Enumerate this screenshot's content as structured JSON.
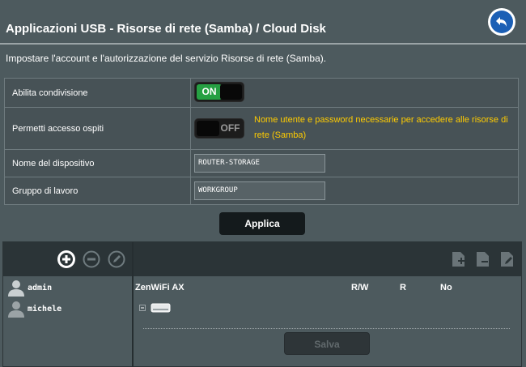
{
  "header": {
    "title": "Applicazioni USB - Risorse di rete (Samba) / Cloud Disk",
    "subtitle": "Impostare l'account e l'autorizzazione del servizio Risorse di rete (Samba)."
  },
  "settings": {
    "enable_share": {
      "label": "Abilita condivisione",
      "toggle_text": "ON",
      "state": "on"
    },
    "guest_access": {
      "label": "Permetti accesso ospiti",
      "toggle_text": "OFF",
      "state": "off",
      "hint": "Nome utente e password necessarie per accedere alle risorse di rete (Samba)"
    },
    "device_name": {
      "label": "Nome del dispositivo",
      "value": "ROUTER-STORAGE"
    },
    "workgroup": {
      "label": "Gruppo di lavoro",
      "value": "WORKGROUP"
    }
  },
  "buttons": {
    "apply": "Applica",
    "save": "Salva"
  },
  "users": [
    {
      "name": "admin"
    },
    {
      "name": "michele"
    }
  ],
  "share_table": {
    "device": "ZenWiFi AX",
    "columns": [
      "R/W",
      "R",
      "No"
    ]
  },
  "colors": {
    "background": "#4d5a5e",
    "toggle_on": "#26a043",
    "hint": "#ffcc00",
    "back_button": "#1b5fb5"
  },
  "icons": {
    "back": "back-arrow-icon",
    "add_user": "plus-circle-icon",
    "remove_user": "minus-circle-icon",
    "edit_user": "pencil-circle-icon",
    "add_folder": "add-folder-icon",
    "delete_folder": "delete-folder-icon",
    "edit_folder": "edit-folder-icon",
    "user": "user-silhouette-icon",
    "drive": "drive-icon"
  }
}
